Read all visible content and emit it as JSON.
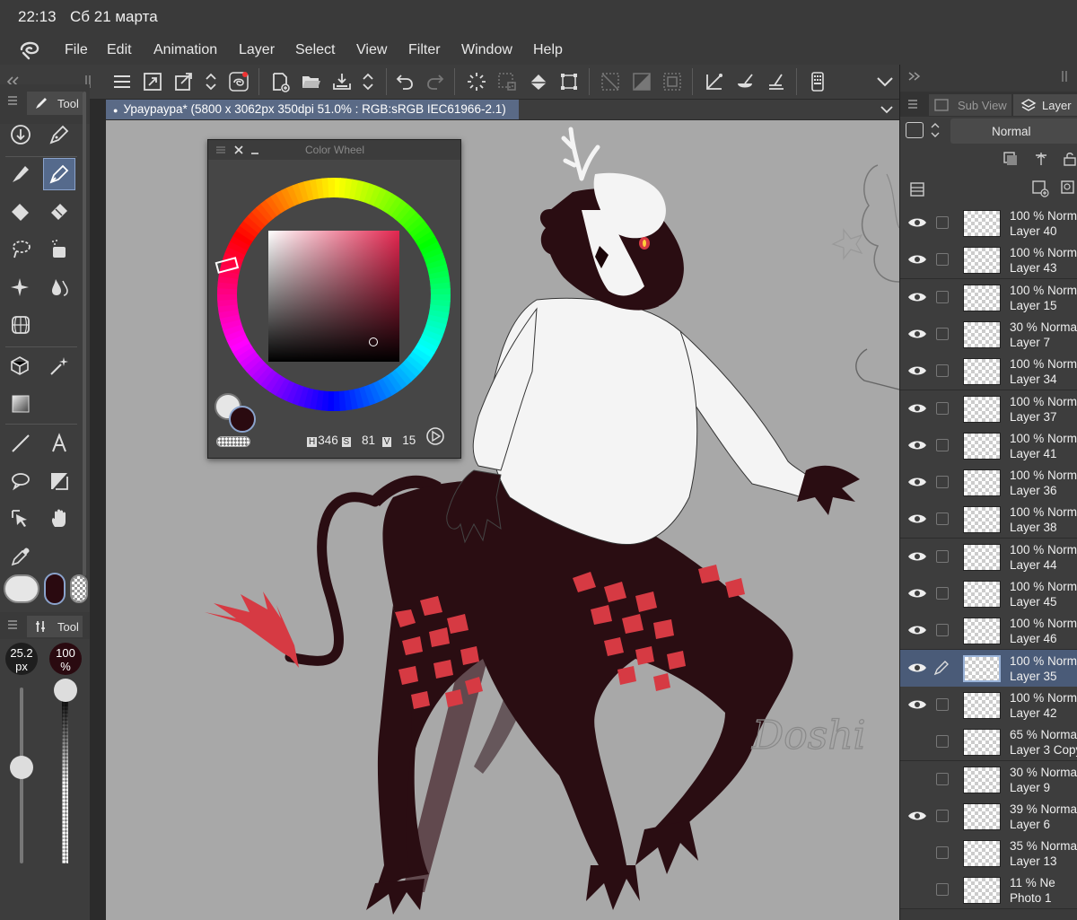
{
  "status": {
    "time": "22:13",
    "date": "Сб 21 марта"
  },
  "menu": [
    "File",
    "Edit",
    "Animation",
    "Layer",
    "Select",
    "View",
    "Filter",
    "Window",
    "Help"
  ],
  "document": {
    "tab_title": "Урауpаурa* (5800 x 3062px 350dpi 51.0% : RGB:sRGB IEC61966-2.1)"
  },
  "left_panel": {
    "tool_tab": "Tool",
    "sub_tool_tab": "Tool",
    "brush_size": {
      "value": "25.2",
      "unit": "px"
    },
    "opacity": {
      "value": "100",
      "unit": "%"
    }
  },
  "color_wheel": {
    "title": "Color Wheel",
    "h_label": "H",
    "h_value": "346",
    "s_label": "S",
    "s_value": "81",
    "v_label": "V",
    "v_value": "15",
    "main_color": "#2a0a10",
    "sub_color": "#e6e6e6",
    "hue_color": "#e3264f"
  },
  "right_panel": {
    "subview_tab": "Sub View",
    "layer_tab": "Layer",
    "blend_mode": "Normal",
    "layers": [
      {
        "opacity": "100 %",
        "mode": "Norm",
        "name": "Layer 40",
        "visible": true,
        "selected": false
      },
      {
        "opacity": "100 %",
        "mode": "Norm",
        "name": "Layer 43",
        "visible": true,
        "selected": false
      },
      {
        "opacity": "100 %",
        "mode": "Norm",
        "name": "Layer 15",
        "visible": true,
        "selected": false
      },
      {
        "opacity": "30 %",
        "mode": "Norma",
        "name": "Layer 7",
        "visible": true,
        "selected": false
      },
      {
        "opacity": "100 %",
        "mode": "Norm",
        "name": "Layer 34",
        "visible": true,
        "selected": false
      },
      {
        "opacity": "100 %",
        "mode": "Norm",
        "name": "Layer 37",
        "visible": true,
        "selected": false
      },
      {
        "opacity": "100 %",
        "mode": "Norm",
        "name": "Layer 41",
        "visible": true,
        "selected": false
      },
      {
        "opacity": "100 %",
        "mode": "Norm",
        "name": "Layer 36",
        "visible": true,
        "selected": false
      },
      {
        "opacity": "100 %",
        "mode": "Norm",
        "name": "Layer 38",
        "visible": true,
        "selected": false
      },
      {
        "opacity": "100 %",
        "mode": "Norm",
        "name": "Layer 44",
        "visible": true,
        "selected": false
      },
      {
        "opacity": "100 %",
        "mode": "Norm",
        "name": "Layer 45",
        "visible": true,
        "selected": false
      },
      {
        "opacity": "100 %",
        "mode": "Norm",
        "name": "Layer 46",
        "visible": true,
        "selected": false
      },
      {
        "opacity": "100 %",
        "mode": "Norm",
        "name": "Layer 35",
        "visible": true,
        "selected": true
      },
      {
        "opacity": "100 %",
        "mode": "Norm",
        "name": "Layer 42",
        "visible": true,
        "selected": false
      },
      {
        "opacity": "65 %",
        "mode": "Norma",
        "name": "Layer 3 Copy",
        "visible": false,
        "selected": false
      },
      {
        "opacity": "30 %",
        "mode": "Norma",
        "name": "Layer 9",
        "visible": false,
        "selected": false
      },
      {
        "opacity": "39 %",
        "mode": "Norma",
        "name": "Layer 6",
        "visible": true,
        "selected": false
      },
      {
        "opacity": "35 %",
        "mode": "Norma",
        "name": "Layer 13",
        "visible": false,
        "selected": false
      },
      {
        "opacity": "11 %",
        "mode": "Ne",
        "name": "Photo 1",
        "visible": false,
        "selected": false
      }
    ]
  },
  "canvas": {
    "signature": "Doshi"
  },
  "colors": {
    "accent": "#556a8c",
    "panel": "#3d3d3d",
    "canvas_bg": "#a8a8a8"
  }
}
